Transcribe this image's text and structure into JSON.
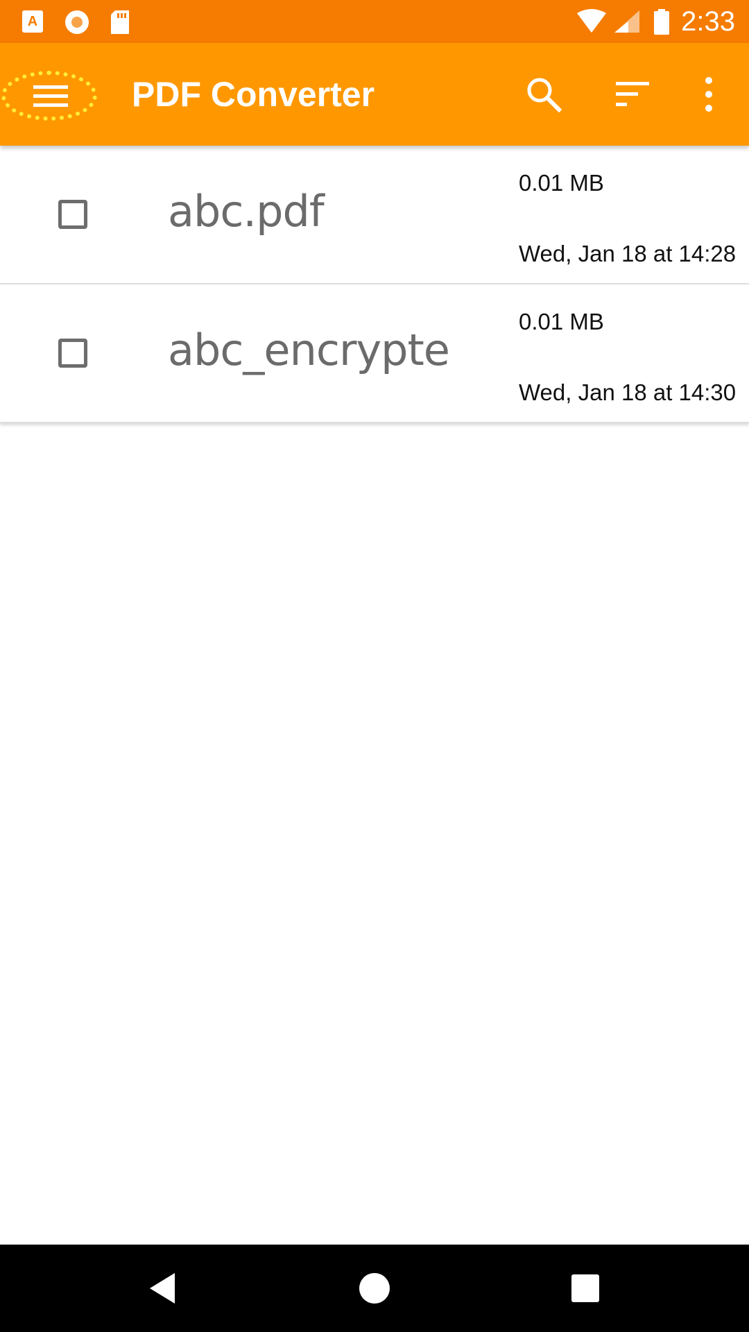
{
  "status_bar": {
    "time": "2:33",
    "left_icons": [
      "a-notification-icon",
      "record-icon",
      "sd-card-icon"
    ],
    "right_icons": [
      "wifi-icon",
      "cell-signal-icon",
      "battery-icon"
    ]
  },
  "app_bar": {
    "title": "PDF Converter",
    "actions": [
      "search-icon",
      "sort-icon",
      "more-vert-icon"
    ]
  },
  "files": [
    {
      "name": "abc.pdf",
      "size": "0.01 MB",
      "date": "Wed, Jan 18 at 14:28",
      "checked": false
    },
    {
      "name": "abc_encrypte",
      "size": "0.01 MB",
      "date": "Wed, Jan 18 at 14:30",
      "checked": false
    }
  ],
  "colors": {
    "status_bar": "#F57C00",
    "app_bar": "#FF9800",
    "highlight_ring": "#FFEB3B",
    "nav_bar": "#000000"
  }
}
